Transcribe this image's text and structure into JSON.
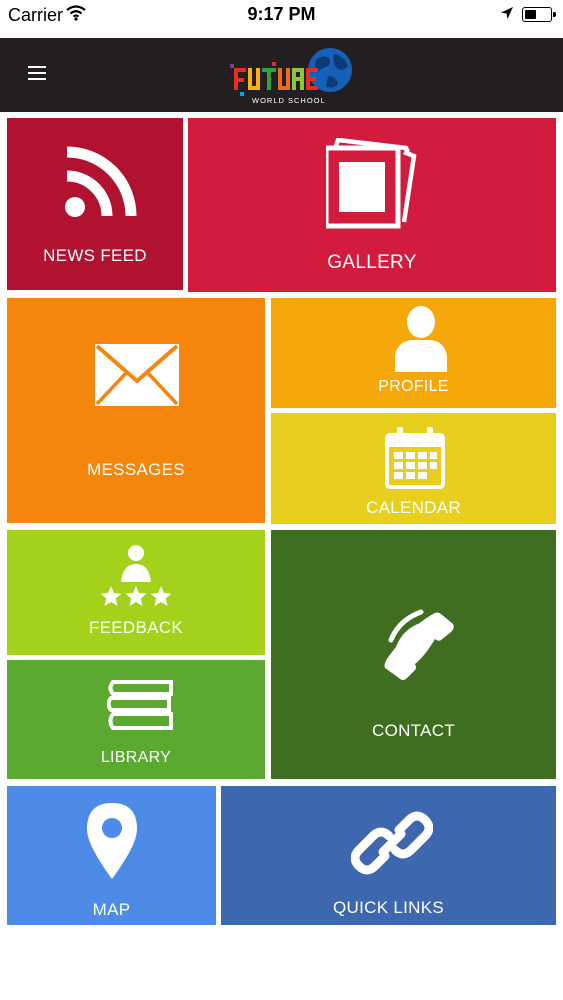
{
  "status_bar": {
    "carrier": "Carrier",
    "time": "9:17 PM"
  },
  "header": {
    "logo_icon": "future-world-school-logo",
    "logo_text": "FUTURE",
    "logo_subtext": "WORLD SCHOOL"
  },
  "tiles": {
    "news_feed": {
      "label": "NEWS FEED",
      "color": "#b0122f",
      "icon": "rss-icon"
    },
    "gallery": {
      "label": "GALLERY",
      "color": "#d21c3d",
      "icon": "gallery-icon"
    },
    "messages": {
      "label": "MESSAGES",
      "color": "#f5850d",
      "icon": "envelope-icon"
    },
    "profile": {
      "label": "PROFILE",
      "color": "#f6a80a",
      "icon": "user-icon"
    },
    "calendar": {
      "label": "CALENDAR",
      "color": "#e8cf1e",
      "icon": "calendar-icon"
    },
    "feedback": {
      "label": "FEEDBACK",
      "color": "#a3d11c",
      "icon": "feedback-stars-icon"
    },
    "library": {
      "label": "LIBRARY",
      "color": "#5ba930",
      "icon": "books-icon"
    },
    "contact": {
      "label": "CONTACT",
      "color": "#3f6e20",
      "icon": "phone-icon"
    },
    "map": {
      "label": "MAP",
      "color": "#4e8be6",
      "icon": "map-pin-icon"
    },
    "quick_links": {
      "label": "QUICK LINKS",
      "color": "#3d67ae",
      "icon": "link-icon"
    }
  }
}
